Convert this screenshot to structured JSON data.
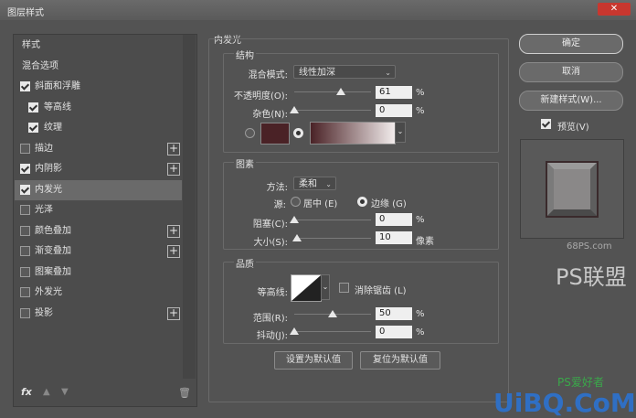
{
  "window": {
    "title": "图层样式",
    "close_icon": "✕"
  },
  "left": {
    "items": [
      {
        "label": "样式",
        "checkbox": false,
        "checked": false,
        "plus": false,
        "selected": false
      },
      {
        "label": "混合选项",
        "checkbox": false,
        "checked": false,
        "plus": false,
        "selected": false
      },
      {
        "label": "斜面和浮雕",
        "checkbox": true,
        "checked": true,
        "plus": false,
        "selected": false,
        "indent": 0
      },
      {
        "label": "等高线",
        "checkbox": true,
        "checked": true,
        "plus": false,
        "selected": false,
        "indent": 1
      },
      {
        "label": "纹理",
        "checkbox": true,
        "checked": true,
        "plus": false,
        "selected": false,
        "indent": 1
      },
      {
        "label": "描边",
        "checkbox": true,
        "checked": false,
        "plus": true,
        "selected": false
      },
      {
        "label": "内阴影",
        "checkbox": true,
        "checked": true,
        "plus": true,
        "selected": false
      },
      {
        "label": "内发光",
        "checkbox": true,
        "checked": true,
        "plus": false,
        "selected": true
      },
      {
        "label": "光泽",
        "checkbox": true,
        "checked": false,
        "plus": false,
        "selected": false
      },
      {
        "label": "颜色叠加",
        "checkbox": true,
        "checked": false,
        "plus": true,
        "selected": false
      },
      {
        "label": "渐变叠加",
        "checkbox": true,
        "checked": false,
        "plus": true,
        "selected": false
      },
      {
        "label": "图案叠加",
        "checkbox": true,
        "checked": false,
        "plus": false,
        "selected": false
      },
      {
        "label": "外发光",
        "checkbox": true,
        "checked": false,
        "plus": false,
        "selected": false
      },
      {
        "label": "投影",
        "checkbox": true,
        "checked": false,
        "plus": true,
        "selected": false
      }
    ],
    "footer": {
      "fx": "fx",
      "up_icon": "▲",
      "down_icon": "▼",
      "trash_icon": "🗑"
    }
  },
  "inner_glow": {
    "title": "内发光",
    "structure": {
      "title": "结构",
      "blend_mode_label": "混合模式:",
      "blend_mode_value": "线性加深",
      "opacity_label": "不透明度(O):",
      "opacity_value": "61",
      "opacity_fraction": 0.61,
      "noise_label": "杂色(N):",
      "noise_value": "0",
      "noise_fraction": 0,
      "percent": "%",
      "color": "#4a2226",
      "gradient_start": "#4a2226",
      "gradient_end": "#f2ecec"
    },
    "elements": {
      "title": "图素",
      "method_label": "方法:",
      "method_value": "柔和",
      "source_label": "源:",
      "source_center": "居中 (E)",
      "source_edge": "边缘 (G)",
      "choke_label": "阻塞(C):",
      "choke_value": "0",
      "choke_fraction": 0,
      "size_label": "大小(S):",
      "size_value": "10",
      "size_fraction": 0.04,
      "percent": "%",
      "pixels": "像素"
    },
    "quality": {
      "title": "品质",
      "contour_label": "等高线:",
      "antialias_label": "消除锯齿 (L)",
      "range_label": "范围(R):",
      "range_value": "50",
      "range_fraction": 0.5,
      "jitter_label": "抖动(J):",
      "jitter_value": "0",
      "jitter_fraction": 0,
      "percent": "%"
    },
    "set_default": "设置为默认值",
    "reset_default": "复位为默认值"
  },
  "right": {
    "ok": "确定",
    "cancel": "取消",
    "new_style": "新建样式(W)...",
    "preview_label": "预览(V)",
    "preview_checked": true
  },
  "watermarks": {
    "site1": "68PS.com",
    "logo1": "PS联盟",
    "site2": "UiBQ.CoM",
    "logo2": "PS爱好者"
  }
}
